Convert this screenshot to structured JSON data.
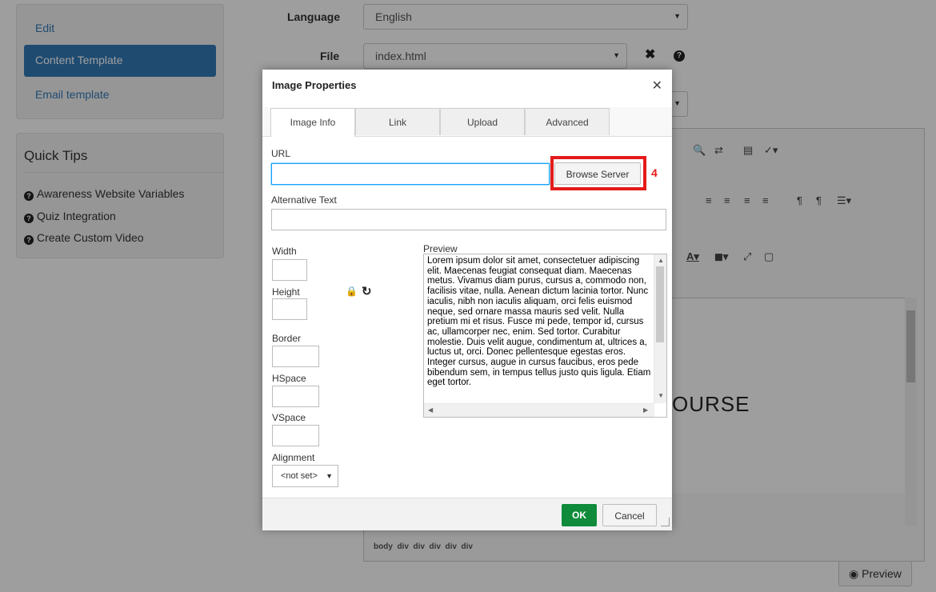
{
  "sidebar": {
    "items": [
      {
        "label": "Edit"
      },
      {
        "label": "Content Template"
      },
      {
        "label": "Email template"
      }
    ],
    "quick_tips": {
      "title": "Quick Tips",
      "items": [
        {
          "label": "Awareness Website Variables"
        },
        {
          "label": "Quiz Integration"
        },
        {
          "label": "Create Custom Video"
        }
      ]
    }
  },
  "form": {
    "language_label": "Language",
    "language_value": "English",
    "file_label": "File",
    "file_value": "index.html"
  },
  "editor": {
    "content_heading": "OURSE",
    "path": [
      "body",
      "div",
      "div",
      "div",
      "div",
      "div"
    ],
    "preview_label": "Preview"
  },
  "dialog": {
    "title": "Image Properties",
    "close_glyph": "✕",
    "tabs": [
      {
        "label": "Image Info",
        "active": true
      },
      {
        "label": "Link",
        "active": false
      },
      {
        "label": "Upload",
        "active": false
      },
      {
        "label": "Advanced",
        "active": false
      }
    ],
    "url_label": "URL",
    "url_value": "",
    "browse_label": "Browse Server",
    "step_number": "4",
    "alt_label": "Alternative Text",
    "alt_value": "",
    "width_label": "Width",
    "height_label": "Height",
    "border_label": "Border",
    "hspace_label": "HSpace",
    "vspace_label": "VSpace",
    "alignment_label": "Alignment",
    "alignment_value": "<not set>",
    "preview_label": "Preview",
    "preview_text": "Lorem ipsum dolor sit amet, consectetuer adipiscing elit. Maecenas feugiat consequat diam. Maecenas metus. Vivamus diam purus, cursus a, commodo non, facilisis vitae, nulla. Aenean dictum lacinia tortor. Nunc iaculis, nibh non iaculis aliquam, orci felis euismod neque, sed ornare massa mauris sed velit. Nulla pretium mi et risus. Fusce mi pede, tempor id, cursus ac, ullamcorper nec, enim. Sed tortor. Curabitur molestie. Duis velit augue, condimentum at, ultrices a, luctus ut, orci. Donec pellentesque egestas eros. Integer cursus, augue in cursus faucibus, eros pede bibendum sem, in tempus tellus justo quis ligula. Etiam eget tortor.",
    "ok_label": "OK",
    "cancel_label": "Cancel"
  },
  "colors": {
    "primary": "#337ab7",
    "ok_green": "#0f8b3b",
    "highlight_red": "#e41b1b",
    "focus_blue": "#139ff7"
  },
  "icons": [
    "question-circle-icon",
    "close-icon",
    "lock-icon",
    "reset-icon",
    "eye-icon",
    "caret-down-icon"
  ]
}
